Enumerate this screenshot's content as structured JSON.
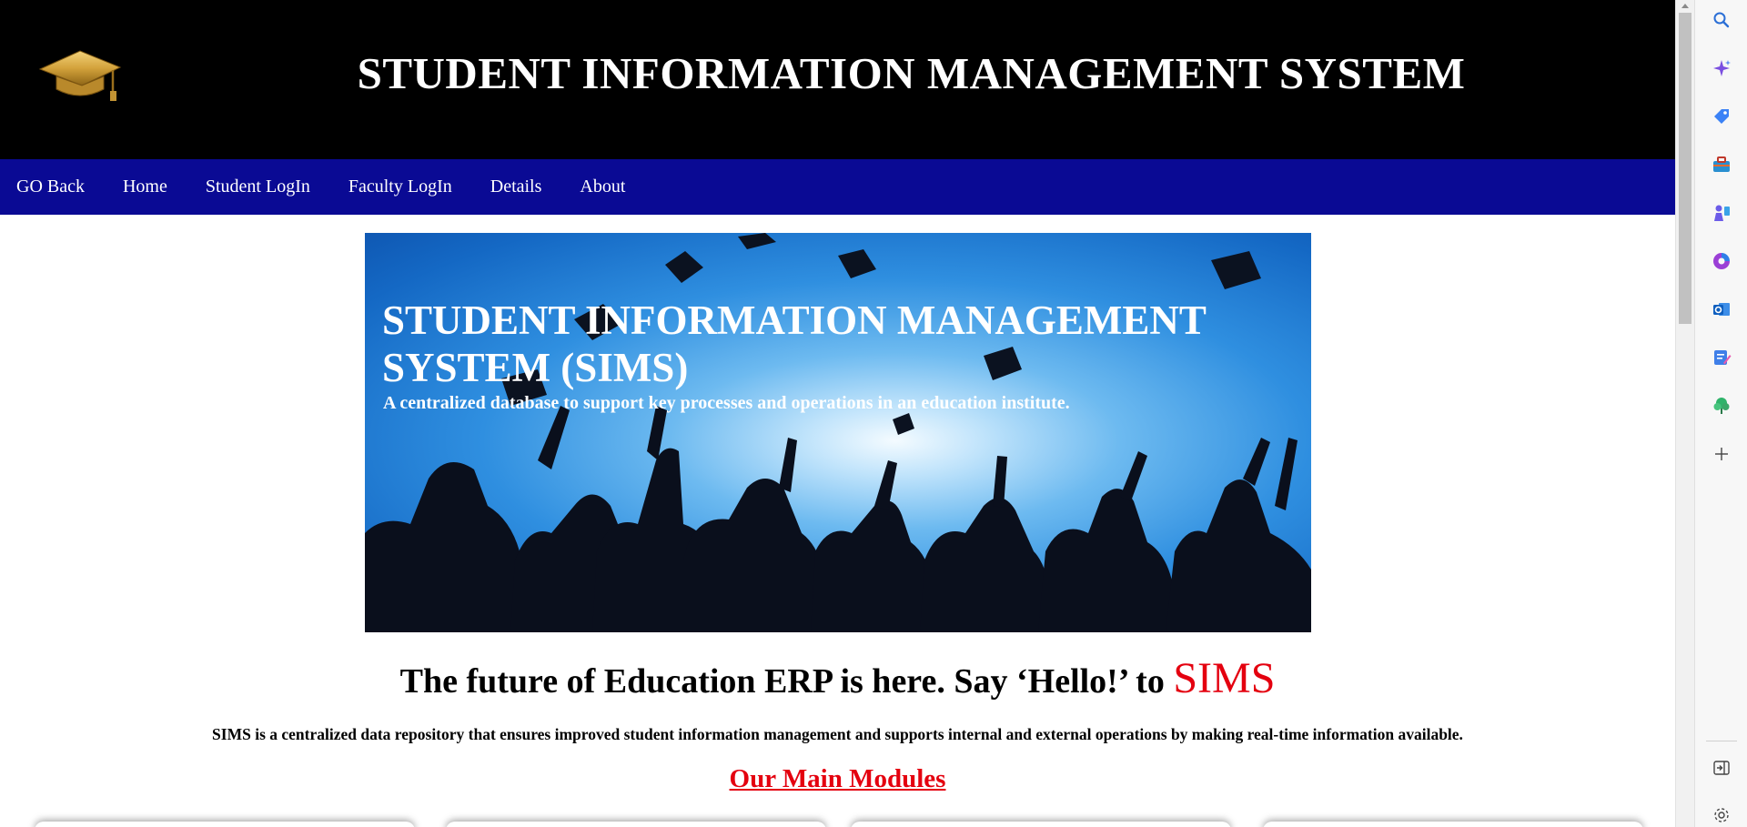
{
  "header": {
    "title": "STUDENT INFORMATION MANAGEMENT SYSTEM",
    "logo_icon": "graduation-cap-icon"
  },
  "nav": {
    "items": [
      {
        "label": "GO Back"
      },
      {
        "label": "Home"
      },
      {
        "label": "Student LogIn"
      },
      {
        "label": "Faculty LogIn"
      },
      {
        "label": "Details"
      },
      {
        "label": "About"
      }
    ]
  },
  "hero": {
    "title": "STUDENT INFORMATION MANAGEMENT SYSTEM (SIMS)",
    "subtitle": "A centralized database to support key processes and operations in an education institute."
  },
  "intro": {
    "tagline_prefix": "The future of Education ERP is here. Say ‘Hello!’ to ",
    "tagline_brand": "SIMS",
    "description": "SIMS is a centralized data repository that ensures improved student information management and supports internal and external operations by making real-time information available.",
    "modules_heading": "Our Main Modules"
  },
  "colors": {
    "header_bg": "#000000",
    "nav_bg": "#0a0a94",
    "accent_red": "#e4000f"
  },
  "sidebar": {
    "icons": [
      "search-icon",
      "copilot-icon",
      "shopping-tag-icon",
      "tools-briefcase-icon",
      "games-icon",
      "office-icon",
      "outlook-icon",
      "designer-icon",
      "tree-icon",
      "add-icon",
      "panel-collapse-icon",
      "settings-icon"
    ]
  }
}
